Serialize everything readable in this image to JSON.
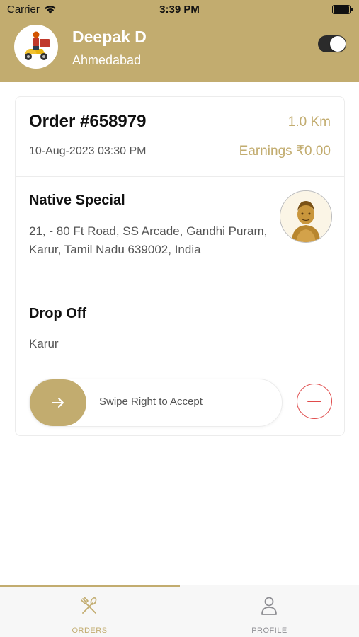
{
  "status_bar": {
    "carrier": "Carrier",
    "time": "3:39 PM"
  },
  "header": {
    "user_name": "Deepak D",
    "user_city": "Ahmedabad",
    "online_toggle": true
  },
  "order": {
    "number": "Order #658979",
    "distance": "1.0 Km",
    "date": "10-Aug-2023 03:30 PM",
    "earnings": "Earnings ₹0.00",
    "restaurant_name": "Native Special",
    "restaurant_address": "21, - 80 Ft Road, SS Arcade, Gandhi Puram, Karur, Tamil Nadu 639002, India",
    "drop_title": "Drop Off",
    "drop_place": "Karur",
    "swipe_label": "Swipe Right to Accept"
  },
  "tabs": [
    {
      "label": "ORDERS",
      "icon": "fork-knife-icon",
      "active": true
    },
    {
      "label": "PROFILE",
      "icon": "person-icon",
      "active": false
    }
  ],
  "colors": {
    "accent": "#c2ac6f",
    "decline": "#e04b4b",
    "text": "#111111",
    "muted": "#555555"
  }
}
